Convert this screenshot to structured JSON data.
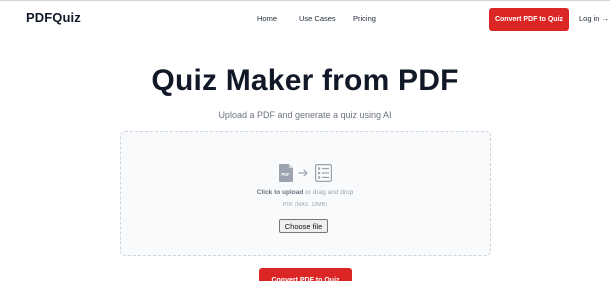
{
  "header": {
    "logo": "PDFQuiz",
    "nav": [
      "Home",
      "Use Cases",
      "Pricing"
    ],
    "cta_label": "Convert PDF to Quiz",
    "login_label": "Log in →"
  },
  "hero": {
    "title": "Quiz Maker from PDF",
    "subtitle": "Upload a PDF and generate a quiz using AI"
  },
  "upload": {
    "icons": [
      "pdf-file-icon",
      "arrow-right-icon",
      "checklist-icon"
    ],
    "pdf_icon_label": "PDF",
    "click_label": "Click to upload",
    "drag_label": " or drag and drop",
    "hint": "PDF (MAX. 10MB)",
    "choose_file_label": "Choose file"
  },
  "main_cta": {
    "label": "Convert PDF to Quiz"
  },
  "colors": {
    "accent": "#dc2626",
    "text": "#111827",
    "muted": "#6b7280",
    "dropzone_bg": "#f9fafb",
    "dropzone_border": "#cbd5e1"
  }
}
